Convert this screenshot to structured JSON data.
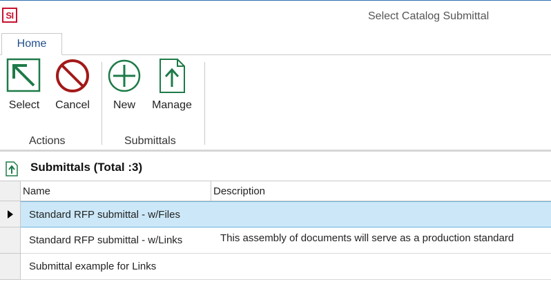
{
  "app": {
    "logo_text": "SI",
    "window_title": "Select Catalog Submittal"
  },
  "tabs": [
    {
      "label": "Home"
    }
  ],
  "ribbon": {
    "groups": [
      {
        "label": "Actions"
      },
      {
        "label": "Submittals"
      }
    ],
    "buttons": {
      "select": "Select",
      "cancel": "Cancel",
      "new": "New",
      "manage": "Manage"
    }
  },
  "panel": {
    "title": "Submittals (Total :3)"
  },
  "grid": {
    "columns": [
      "Name",
      "Description"
    ],
    "rows": [
      {
        "name": "Standard RFP submittal - w/Files",
        "description": "",
        "selected": true
      },
      {
        "name": "Standard RFP submittal - w/Links",
        "description": "This assembly of documents will serve as a production standard",
        "selected": false
      },
      {
        "name": "Submittal example for Links",
        "description": "",
        "selected": false
      }
    ]
  },
  "colors": {
    "accent_green": "#1e7a48",
    "cancel_red": "#a31919",
    "selection_bg": "#cce8f8",
    "tab_text": "#1f4e8c",
    "logo_red": "#c8102e"
  }
}
